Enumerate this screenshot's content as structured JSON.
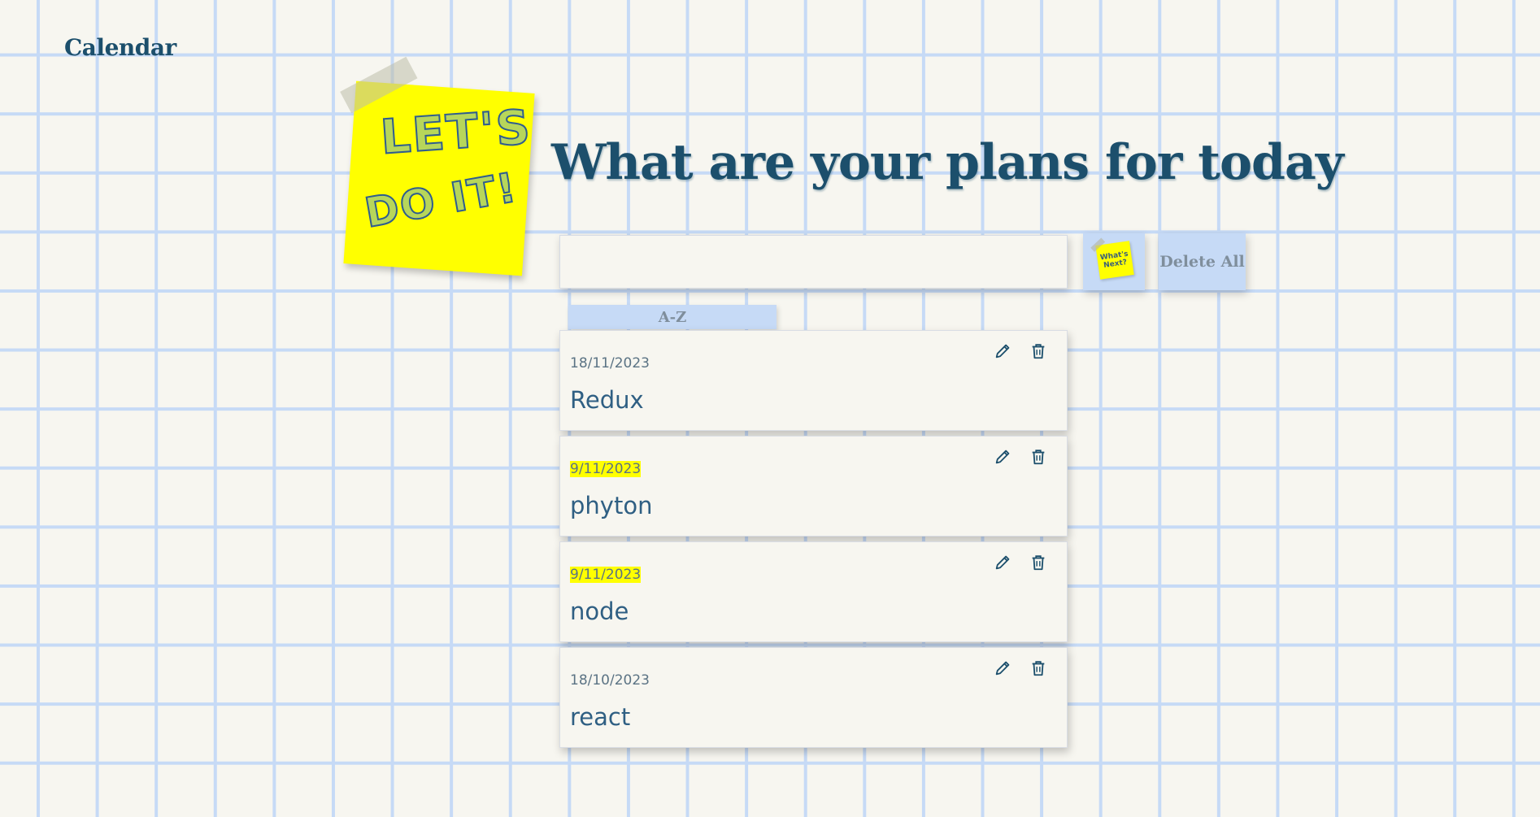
{
  "nav": {
    "calendar_label": "Calendar"
  },
  "sticky_note": {
    "line1": "LET'S",
    "line2": "DO IT!"
  },
  "heading": "What are your plans for today",
  "input": {
    "value": "",
    "placeholder": ""
  },
  "buttons": {
    "whats_next_line1": "What's",
    "whats_next_line2": "Next?",
    "delete_all": "Delete All",
    "sort": "A-Z"
  },
  "tasks": [
    {
      "date": "18/11/2023",
      "text": "Redux",
      "date_highlighted": false
    },
    {
      "date": "9/11/2023",
      "text": "phyton",
      "date_highlighted": true
    },
    {
      "date": "9/11/2023",
      "text": "node",
      "date_highlighted": true
    },
    {
      "date": "18/10/2023",
      "text": "react",
      "date_highlighted": false
    }
  ],
  "icons": {
    "edit": "pencil-icon",
    "delete": "trash-icon"
  },
  "colors": {
    "background": "#f7f6f0",
    "grid_line": "#c6daf6",
    "heading": "#1c4f6c",
    "sticky": "#ffff00",
    "button": "#c6daf6",
    "date_highlight": "#ffff00"
  }
}
